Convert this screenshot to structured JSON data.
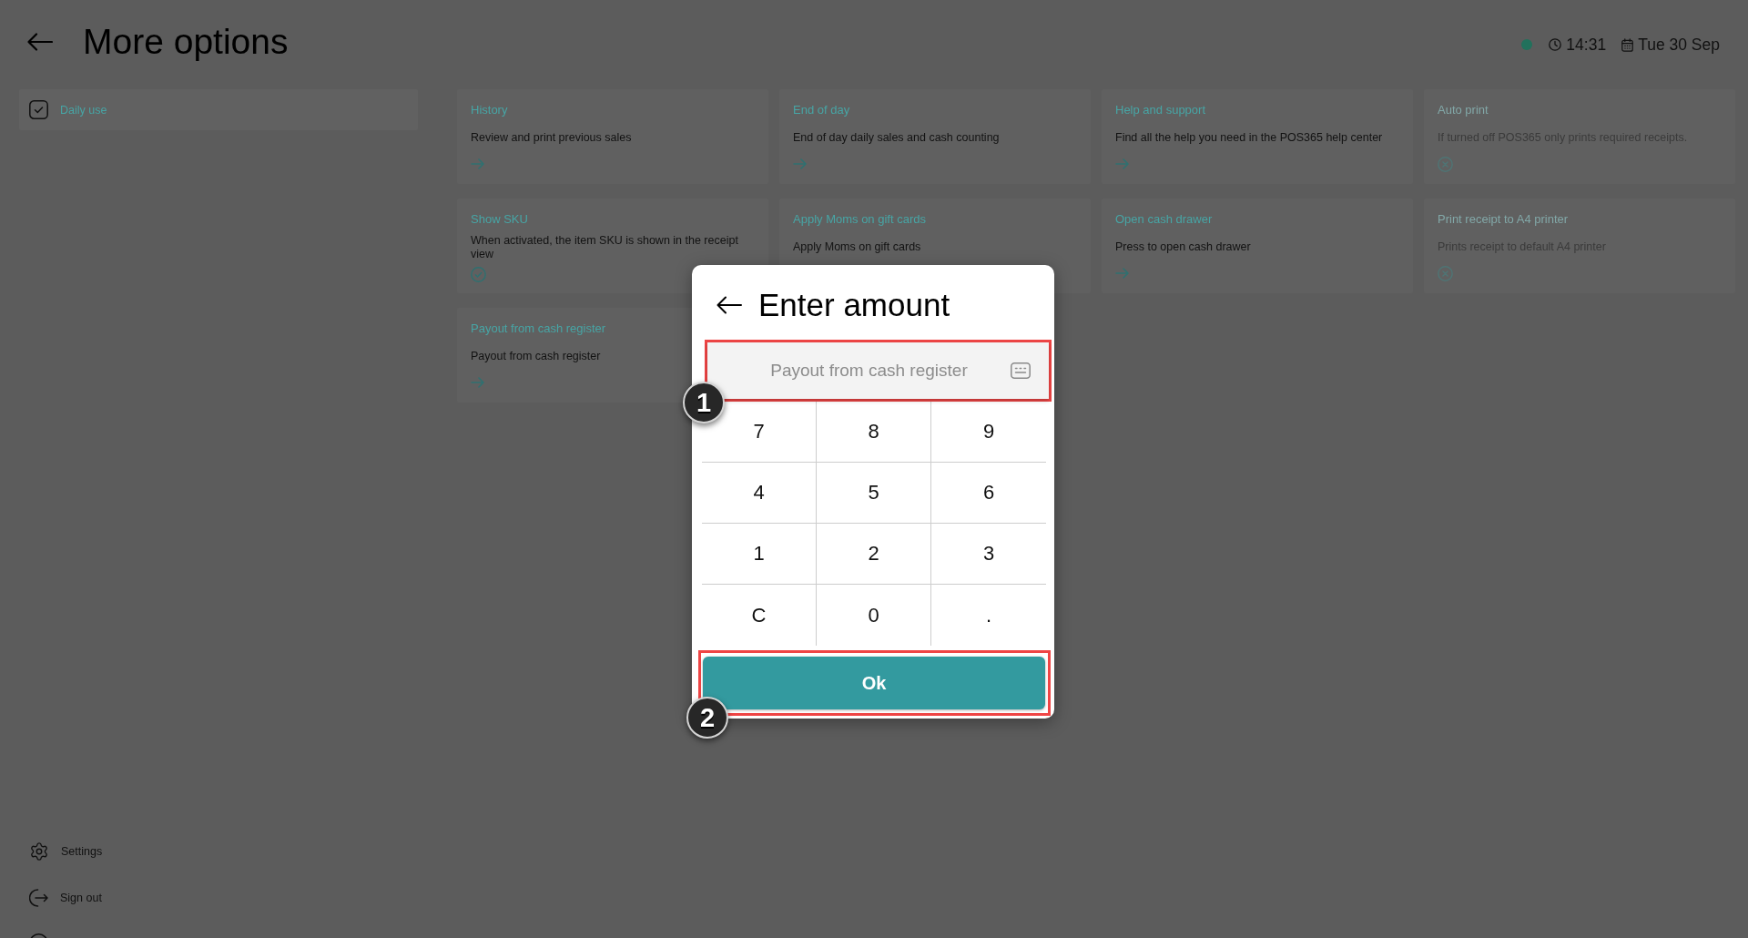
{
  "header": {
    "title": "More options",
    "online": true,
    "time": "14:31",
    "date": "Tue 30 Sep"
  },
  "sidebar": {
    "items": [
      {
        "label": "Daily use",
        "selected": true
      }
    ],
    "footer_items": [
      {
        "label": "Settings",
        "kind": "settings"
      },
      {
        "label": "Sign out",
        "kind": "sign-out"
      },
      {
        "kind": "partial"
      }
    ]
  },
  "cards": [
    {
      "title": "History",
      "description": "Review and print previous sales",
      "kind": "link"
    },
    {
      "title": "End of day",
      "description": "End of day daily sales and cash counting",
      "kind": "link"
    },
    {
      "title": "Help and support",
      "description": "Find all the help you need in the POS365 help center",
      "kind": "link"
    },
    {
      "title": "Auto print",
      "description": "If turned off POS365 only prints required receipts.",
      "kind": "toggle",
      "on": false
    },
    {
      "title": "Show SKU",
      "description": "When activated, the item SKU is shown in the receipt view",
      "kind": "toggle",
      "on": true
    },
    {
      "title": "Apply Moms on gift cards",
      "description": "Apply Moms on gift cards",
      "kind": "text"
    },
    {
      "title": "Open cash drawer",
      "description": "Press to open cash drawer",
      "kind": "link"
    },
    {
      "title": "Print receipt to A4 printer",
      "description": "Prints receipt to default A4 printer",
      "kind": "toggle",
      "on": false
    },
    {
      "title": "Payout from cash register",
      "description": "Payout from cash register",
      "kind": "link"
    }
  ],
  "dialog": {
    "title": "Enter amount",
    "field": {
      "placeholder": "Payout from cash register",
      "annotation": "1"
    },
    "keys": [
      "7",
      "8",
      "9",
      "4",
      "5",
      "6",
      "1",
      "2",
      "3",
      "C",
      "0",
      "."
    ],
    "confirm": {
      "label": "Ok",
      "annotation": "2"
    }
  }
}
